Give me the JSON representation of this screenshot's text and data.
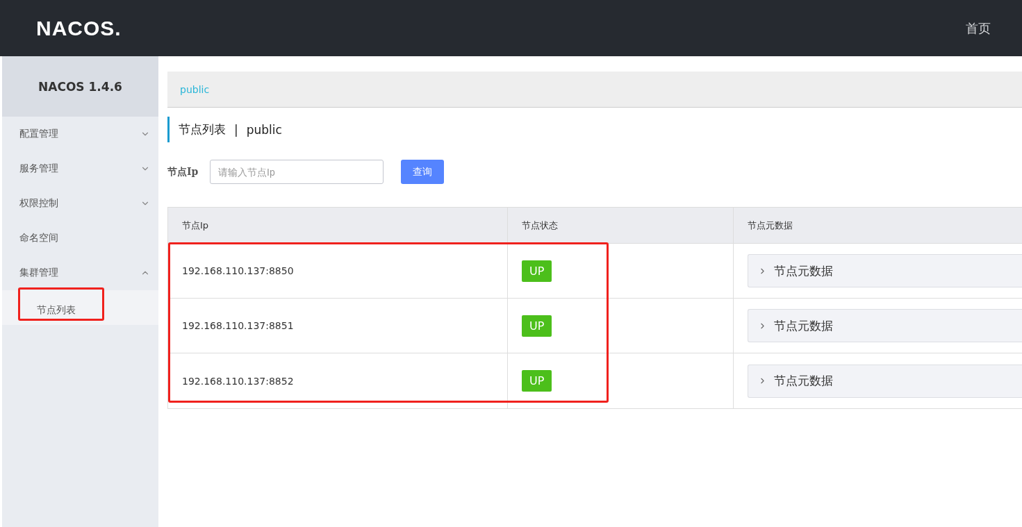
{
  "header": {
    "logo": "NACOS.",
    "nav": [
      "首页"
    ]
  },
  "sidebar": {
    "title": "NACOS 1.4.6",
    "items": [
      {
        "kind": "group",
        "label": "配置管理",
        "expanded": false
      },
      {
        "kind": "group",
        "label": "服务管理",
        "expanded": false
      },
      {
        "kind": "group",
        "label": "权限控制",
        "expanded": false
      },
      {
        "kind": "link",
        "label": "命名空间"
      },
      {
        "kind": "group",
        "label": "集群管理",
        "expanded": true,
        "children": [
          {
            "label": "节点列表",
            "selected": true
          }
        ]
      }
    ]
  },
  "breadcrumb": "public",
  "page_title": {
    "title": "节点列表",
    "separator": "|",
    "namespace": "public"
  },
  "search": {
    "label": "节点Ip",
    "placeholder": "请输入节点Ip",
    "button": "查询"
  },
  "table": {
    "columns": [
      "节点Ip",
      "节点状态",
      "节点元数据"
    ],
    "rows": [
      {
        "ip": "192.168.110.137:8850",
        "state": "UP",
        "metadata": {
          "label": "节点元数据",
          "expanded": false
        }
      },
      {
        "ip": "192.168.110.137:8851",
        "state": "UP",
        "metadata": {
          "label": "节点元数据",
          "expanded": false
        }
      },
      {
        "ip": "192.168.110.137:8852",
        "state": "UP",
        "metadata": {
          "label": "节点元数据",
          "expanded": false
        }
      }
    ]
  }
}
